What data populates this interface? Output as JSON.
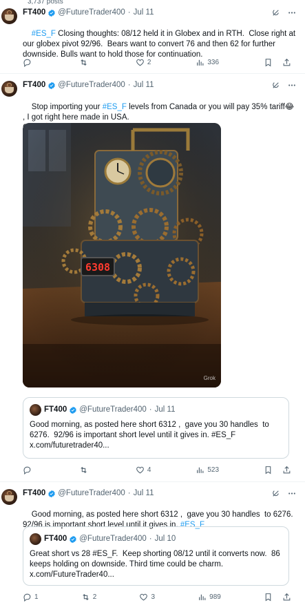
{
  "profile_posts_count": "3,737 posts",
  "tweets": [
    {
      "name": "FT400",
      "handle": "@FutureTrader400",
      "time": "Jul 11",
      "text_parts": [
        {
          "t": "#ES_F",
          "link": true
        },
        {
          "t": " Closing thoughts: 08/12 held it in Globex and in RTH.  Close right at our globex pivot 92/96.  Bears want to convert 76 and then 62 for further downside. Bulls want to hold those for continuation.",
          "link": false
        }
      ],
      "actions": {
        "replies": "",
        "reposts": "",
        "likes": "2",
        "views": "336"
      }
    },
    {
      "name": "FT400",
      "handle": "@FutureTrader400",
      "time": "Jul 11",
      "text_parts": [
        {
          "t": "Stop importing your ",
          "link": false
        },
        {
          "t": "#ES_F",
          "link": true
        },
        {
          "t": " levels from Canada or you will pay 35% tariff😂 , I got right here made in USA.\n6308 🔥.",
          "link": false
        }
      ],
      "media": {
        "counter": "6308",
        "watermark": "Grok"
      },
      "quote": {
        "name": "FT400",
        "handle": "@FutureTrader400",
        "time": "Jul 11",
        "text": "Good morning, as posted here short 6312 ,  gave you 30 handles  to 6276.  92/96 is important short level until it gives in. #ES_F\nx.com/futuretrader40..."
      },
      "actions": {
        "replies": "",
        "reposts": "",
        "likes": "4",
        "views": "523"
      }
    },
    {
      "name": "FT400",
      "handle": "@FutureTrader400",
      "time": "Jul 11",
      "text_parts": [
        {
          "t": "Good morning, as posted here short 6312 ,  gave you 30 handles  to 6276.  92/96 is important short level until it gives in. ",
          "link": false
        },
        {
          "t": "#ES_F",
          "link": true
        }
      ],
      "quote": {
        "name": "FT400",
        "handle": "@FutureTrader400",
        "time": "Jul 10",
        "text": "Great short vs 28 #ES_F.  Keep shorting 08/12 until it converts now.  86 keeps holding on downside. Third time could be charm.\nx.com/FutureTrader40..."
      },
      "actions": {
        "replies": "1",
        "reposts": "2",
        "likes": "3",
        "views": "989"
      }
    }
  ],
  "colors": {
    "link": "#1d9bf0",
    "muted": "#536471",
    "verified": "#1d9bf0",
    "border": "#cfd9de"
  },
  "icons": [
    "reply-icon",
    "repost-icon",
    "like-icon",
    "views-icon",
    "bookmark-icon",
    "share-icon",
    "grok-icon",
    "more-icon",
    "verified-icon"
  ]
}
